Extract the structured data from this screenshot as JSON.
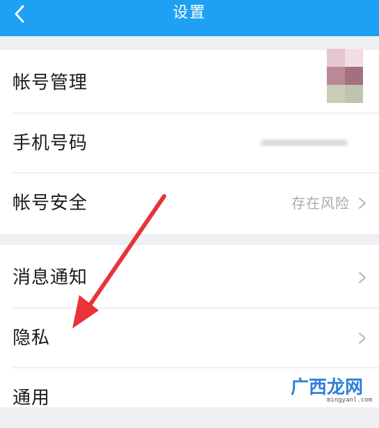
{
  "header": {
    "title": "设置",
    "back_icon": "chevron-left-icon",
    "color": "#1ea1f2"
  },
  "section1": {
    "rows": [
      {
        "label": "帐号管理"
      },
      {
        "label": "手机号码"
      },
      {
        "label": "帐号安全",
        "value": "存在风险"
      }
    ]
  },
  "section2": {
    "rows": [
      {
        "label": "消息通知"
      },
      {
        "label": "隐私"
      },
      {
        "label": "通用"
      }
    ]
  },
  "watermark": {
    "text": "广西龙网",
    "url": "mingyanl.com"
  },
  "annotation": {
    "arrow_color": "#e8333b"
  }
}
